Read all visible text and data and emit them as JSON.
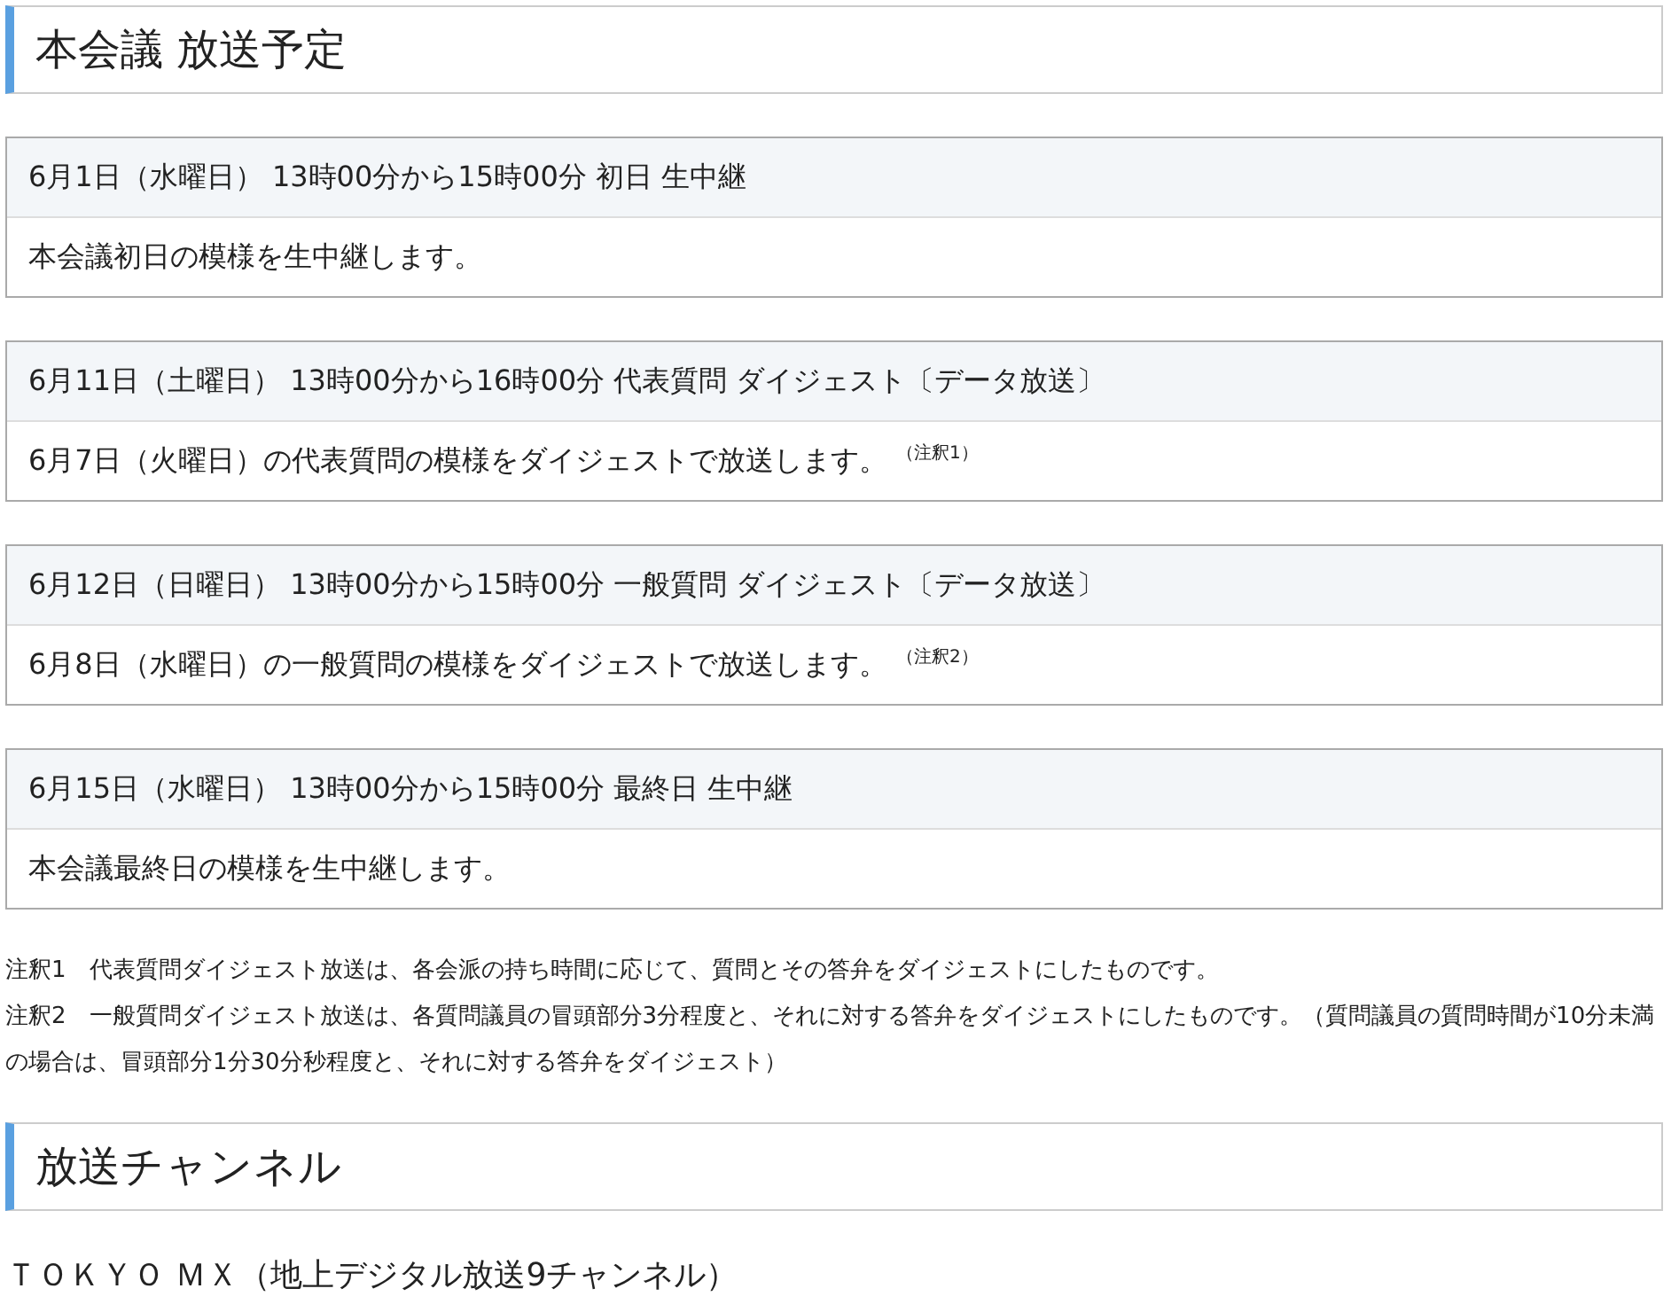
{
  "sections": [
    {
      "kind": "heading",
      "title": "本会議 放送予定"
    },
    {
      "kind": "schedule",
      "items": [
        {
          "header": "6月1日（水曜日） 13時00分から15時00分 初日 生中継",
          "body": "本会議初日の模様を生中継します。"
        },
        {
          "header": "6月11日（土曜日） 13時00分から16時00分 代表質問 ダイジェスト〔データ放送〕",
          "body": "6月7日（火曜日）の代表質問の模様をダイジェストで放送します。 $^{（注釈1）}$"
        },
        {
          "header": "6月12日（日曜日） 13時00分から15時00分 一般質問 ダイジェスト〔データ放送〕",
          "body": "6月8日（水曜日）の一般質問の模様をダイジェストで放送します。 $^{（注釈2）}$"
        },
        {
          "header": "6月15日（水曜日） 13時00分から15時00分 最終日 生中継",
          "body": "本会議最終日の模様を生中継します。"
        }
      ]
    },
    {
      "kind": "notes",
      "items": [
        "注釈1　代表質問ダイジェスト放送は、各会派の持ち時間に応じて、質問とその答弁をダイジェストにしたものです。",
        "注釈2　一般質問ダイジェスト放送は、各質問議員の冒頭部分3分程度と、それに対する答弁をダイジェストにしたものです。（質問議員の質問時間が10分未満の場合は、冒頭部分1分30分秒程度と、それに対する答弁をダイジェスト）"
      ]
    },
    {
      "kind": "heading",
      "title": "放送チャンネル"
    },
    {
      "kind": "paragraph",
      "text": "ＴＯＫＹＯ ＭＸ（地上デジタル放送9チャンネル）"
    }
  ]
}
